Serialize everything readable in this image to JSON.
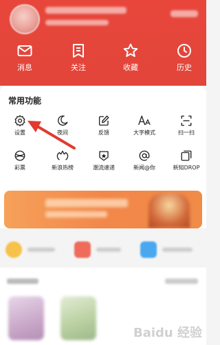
{
  "quick_actions": [
    {
      "label": "消息",
      "icon": "mail-icon"
    },
    {
      "label": "关注",
      "icon": "bookmark-list-icon"
    },
    {
      "label": "收藏",
      "icon": "star-icon"
    },
    {
      "label": "历史",
      "icon": "clock-icon"
    }
  ],
  "common": {
    "title": "常用功能",
    "items": [
      {
        "label": "设置",
        "icon": "gear-icon"
      },
      {
        "label": "夜间",
        "icon": "moon-icon"
      },
      {
        "label": "反馈",
        "icon": "edit-icon"
      },
      {
        "label": "大字模式",
        "icon": "font-size-icon"
      },
      {
        "label": "扫一扫",
        "icon": "scan-icon"
      },
      {
        "label": "彩票",
        "icon": "lottery-icon"
      },
      {
        "label": "新浪热榜",
        "icon": "hot-list-icon"
      },
      {
        "label": "潮流速递",
        "icon": "trend-icon"
      },
      {
        "label": "新闻@你",
        "icon": "at-icon"
      },
      {
        "label": "新知DROP",
        "icon": "copy-icon"
      }
    ]
  },
  "colors": {
    "header": "#e2453a",
    "banner": "#f2874a",
    "arrow": "#e23a2f"
  },
  "watermark": "Baidu 经验"
}
